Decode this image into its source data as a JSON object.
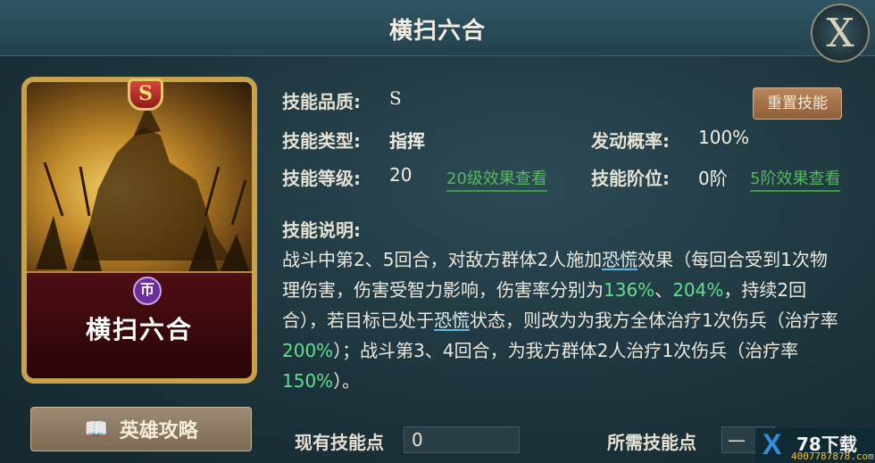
{
  "header": {
    "title": "横扫六合",
    "close_glyph": "X"
  },
  "card": {
    "grade": "S",
    "name": "横扫六合",
    "type_icon": "command-icon",
    "art_colors": {
      "glow": "#f4d06a",
      "frame": "#c8a24a",
      "namebar": "#4d0e14"
    }
  },
  "guide_button": {
    "label": "英雄攻略",
    "icon": "book-icon"
  },
  "info": {
    "quality_label": "技能品质:",
    "quality_value": "S",
    "type_label": "技能类型:",
    "type_value": "指挥",
    "level_label": "技能等级:",
    "level_value": "20",
    "level_link": "20级效果查看",
    "chance_label": "发动概率:",
    "chance_value": "100%",
    "rank_label": "技能阶位:",
    "rank_value": "0阶",
    "rank_link": "5阶效果查看",
    "reset_button": "重置技能"
  },
  "description": {
    "label": "技能说明:",
    "p1": "战斗中第2、5回合，对敌方群体2人施加",
    "k1": "恐慌",
    "p2": "效果（每回合受到1次物理伤害，伤害受智力影响，伤害率分别为",
    "g1": "136%",
    "p3": "、",
    "g2": "204%",
    "p4": "，持续2回合），若目标已处于",
    "k2": "恐慌",
    "p5": "状态，则改为为我方全体治疗1次伤兵（治疗率",
    "g3": "200%",
    "p6": "）；战斗第3、4回合，为我方群体2人治疗1次伤兵（治疗率",
    "g4": "150%",
    "p7": "）。"
  },
  "footer": {
    "current_points_label": "现有技能点",
    "current_points_value": "0",
    "required_points_label": "所需技能点",
    "required_points_value": "—"
  },
  "watermark": {
    "logo": "X",
    "title": "78下载",
    "url": "4007787878.com"
  },
  "colors": {
    "highlight_green": "#5fe08a",
    "link_green": "#54b95c",
    "keyword_underline": "#5fb8e6"
  }
}
